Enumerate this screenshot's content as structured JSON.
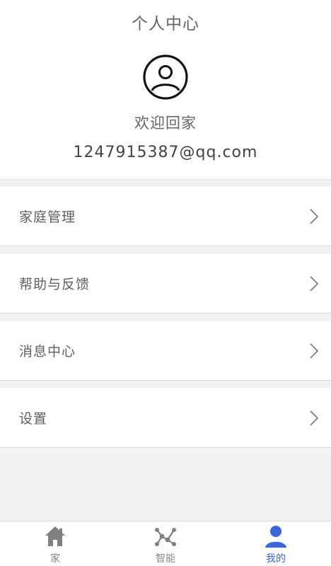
{
  "header": {
    "title": "个人中心",
    "welcome": "欢迎回家",
    "email_partial": "1247915387@qq.com"
  },
  "menu": {
    "items": [
      {
        "label": "家庭管理",
        "icon": "chevron-right-icon"
      },
      {
        "label": "帮助与反馈",
        "icon": "chevron-right-icon"
      },
      {
        "label": "消息中心",
        "icon": "chevron-right-icon"
      },
      {
        "label": "设置",
        "icon": "chevron-right-icon"
      }
    ]
  },
  "tabbar": {
    "tabs": [
      {
        "label": "家",
        "icon": "home-icon",
        "active": false
      },
      {
        "label": "智能",
        "icon": "smart-network-icon",
        "active": false
      },
      {
        "label": "我的",
        "icon": "user-icon",
        "active": true
      }
    ]
  },
  "colors": {
    "accent": "#3a66d8",
    "text_gray": "#666666",
    "background": "#f2f2f2"
  }
}
